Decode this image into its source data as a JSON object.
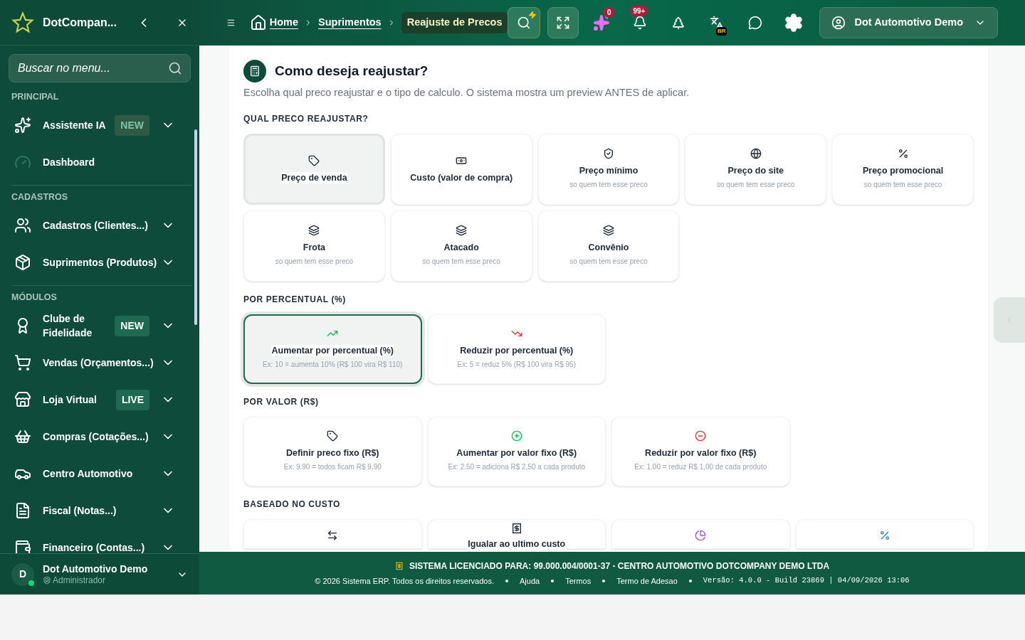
{
  "brand": {
    "name": "DotCompan..."
  },
  "breadcrumb": [
    {
      "label": "Home",
      "kind": "link"
    },
    {
      "label": "Suprimentos",
      "kind": "link"
    },
    {
      "label": "Reajuste de Precos",
      "kind": "current"
    }
  ],
  "header": {
    "ai_count": "0",
    "notifications": "99+",
    "language": "BR",
    "user": "Dot Automotivo Demo"
  },
  "sidebar": {
    "search": {
      "placeholder": "Buscar no menu..."
    },
    "sections": [
      {
        "title": "PRINCIPAL",
        "items": [
          {
            "label": "Assistente IA",
            "badge": "NEW",
            "badge_faded": true,
            "has_submenu": true
          },
          {
            "label": "Dashboard",
            "has_submenu": false,
            "dimmed_icon": true
          }
        ]
      },
      {
        "title": "CADASTROS",
        "items": [
          {
            "label": "Cadastros (Clientes...)",
            "has_submenu": true
          },
          {
            "label": "Suprimentos (Produtos)",
            "has_submenu": true
          }
        ]
      },
      {
        "title": "MÓDULOS",
        "items": [
          {
            "label": "Clube de Fidelidade",
            "badge": "NEW",
            "has_submenu": true
          },
          {
            "label": "Vendas (Orçamentos...)",
            "has_submenu": true
          },
          {
            "label": "Loja Virtual",
            "badge": "LIVE",
            "has_submenu": true
          },
          {
            "label": "Compras (Cotações...)",
            "has_submenu": true
          },
          {
            "label": "Centro Automotivo",
            "has_submenu": true
          },
          {
            "label": "Fiscal (Notas...)",
            "has_submenu": true
          },
          {
            "label": "Financeiro (Contas...)",
            "has_submenu": true
          }
        ]
      }
    ],
    "user": {
      "initial": "D",
      "name": "Dot Automotivo Demo",
      "role": "Administrador",
      "online": true
    }
  },
  "panel": {
    "title": "Como deseja reajustar?",
    "subtitle": "Escolha qual preco reajustar e o tipo de calculo. O sistema mostra um preview ANTES de aplicar.",
    "groups": [
      {
        "title": "QUAL PRECO REAJUSTAR?",
        "options": [
          {
            "label": "Preço de venda",
            "selected": true
          },
          {
            "label": "Custo (valor de compra)",
            "selected": false
          },
          {
            "label": "Preço mínimo",
            "hint": "so quem tem esse preco",
            "selected": false
          },
          {
            "label": "Preço do site",
            "hint": "so quem tem esse preco",
            "selected": false
          },
          {
            "label": "Preço promocional",
            "hint": "so quem tem esse preco",
            "selected": false
          },
          {
            "label": "Frota",
            "hint": "so quem tem esse preco",
            "selected": false
          },
          {
            "label": "Atacado",
            "hint": "so quem tem esse preco",
            "selected": false
          },
          {
            "label": "Convênio",
            "hint": "so quem tem esse preco",
            "selected": false
          }
        ]
      },
      {
        "title": "POR PERCENTUAL (%)",
        "options": [
          {
            "label": "Aumentar por percentual (%)",
            "hint": "Ex: 10 = aumenta 10% (R$ 100 vira R$ 110)",
            "selected": true
          },
          {
            "label": "Reduzir por percentual (%)",
            "hint": "Ex: 5 = reduz 5% (R$ 100 vira R$ 95)",
            "selected": false
          }
        ]
      },
      {
        "title": "POR VALOR (R$)",
        "options": [
          {
            "label": "Definir preco fixo (R$)",
            "hint": "Ex: 9.90 = todos ficam R$ 9,90",
            "selected": false
          },
          {
            "label": "Aumentar por valor fixo (R$)",
            "hint": "Ex: 2.50 = adiciona R$ 2,50 a cada produto",
            "selected": false
          },
          {
            "label": "Reduzir por valor fixo (R$)",
            "hint": "Ex: 1.00 = reduz R$ 1,00 de cada produto",
            "selected": false
          }
        ]
      },
      {
        "title": "BASEADO NO CUSTO",
        "options": [
          {
            "selected": false
          },
          {
            "label": "Igualar ao ultimo custo",
            "selected": false
          },
          {
            "selected": false
          },
          {
            "selected": false
          }
        ]
      }
    ]
  },
  "footer": {
    "license_label": "SISTEMA LICENCIADO PARA:",
    "license_value": "99.000.004/0001-37 - CENTRO AUTOMOTIVO DOTCOMPANY DEMO LTDA",
    "copyright": "© 2026 Sistema ERP. Todos os direitos reservados.",
    "links": [
      "Ajuda",
      "Termos",
      "Termo de Adesao"
    ],
    "version": "Versão: 4.0.0 - Build 23869 | 04/09/2026 13:06"
  }
}
